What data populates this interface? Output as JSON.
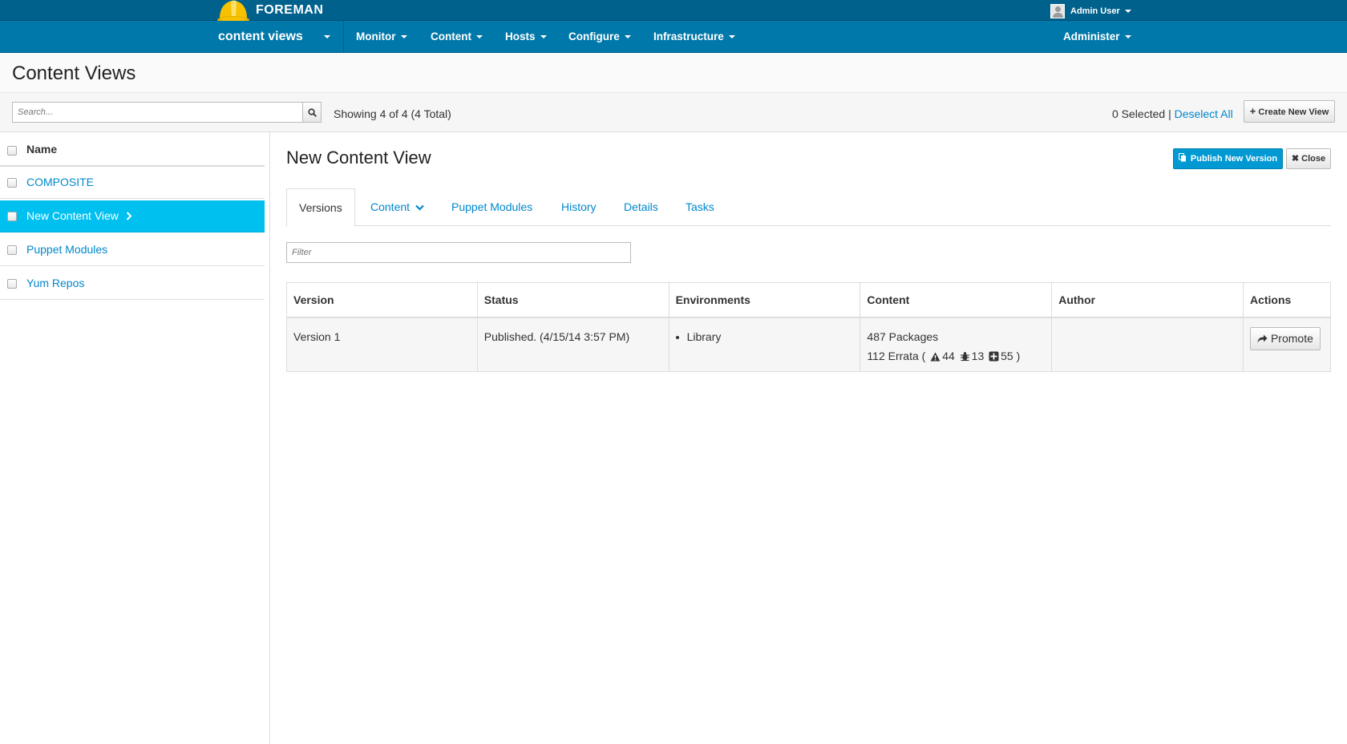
{
  "topbar": {
    "brand": "FOREMAN",
    "user": "Admin User"
  },
  "nav": {
    "context": "content views",
    "items": [
      "Monitor",
      "Content",
      "Hosts",
      "Configure",
      "Infrastructure"
    ],
    "administer": "Administer"
  },
  "page": {
    "title": "Content Views"
  },
  "toolbar": {
    "search_placeholder": "Search...",
    "showing": "Showing 4 of 4 (4 Total)",
    "selected": "0 Selected",
    "separator": "|",
    "deselect_all": "Deselect All",
    "create_new_view": "Create New View"
  },
  "list": {
    "header": "Name",
    "items": [
      {
        "label": "COMPOSITE",
        "active": false
      },
      {
        "label": "New Content View",
        "active": true
      },
      {
        "label": "Puppet Modules",
        "active": false
      },
      {
        "label": "Yum Repos",
        "active": false
      }
    ]
  },
  "detail": {
    "title": "New Content View",
    "publish_button": "Publish New Version",
    "close_button": "Close",
    "tabs": [
      "Versions",
      "Content",
      "Puppet Modules",
      "History",
      "Details",
      "Tasks"
    ],
    "filter_placeholder": "Filter",
    "table": {
      "columns": [
        "Version",
        "Status",
        "Environments",
        "Content",
        "Author",
        "Actions"
      ],
      "rows": [
        {
          "version": "Version 1",
          "status": "Published. (4/15/14 3:57 PM)",
          "environment": "Library",
          "packages": "487 Packages",
          "errata_label": "112 Errata (",
          "errata_security": "44",
          "errata_bug": "13",
          "errata_enhancement": "55",
          "errata_close": ")",
          "author": "",
          "action": "Promote"
        }
      ]
    }
  },
  "colors": {
    "topbar": "#00618c",
    "navbar": "#0078a9",
    "active_row": "#00c0f0",
    "link": "#0088cc",
    "primary_button": "#0099d3",
    "helmet": "#f6c200"
  }
}
